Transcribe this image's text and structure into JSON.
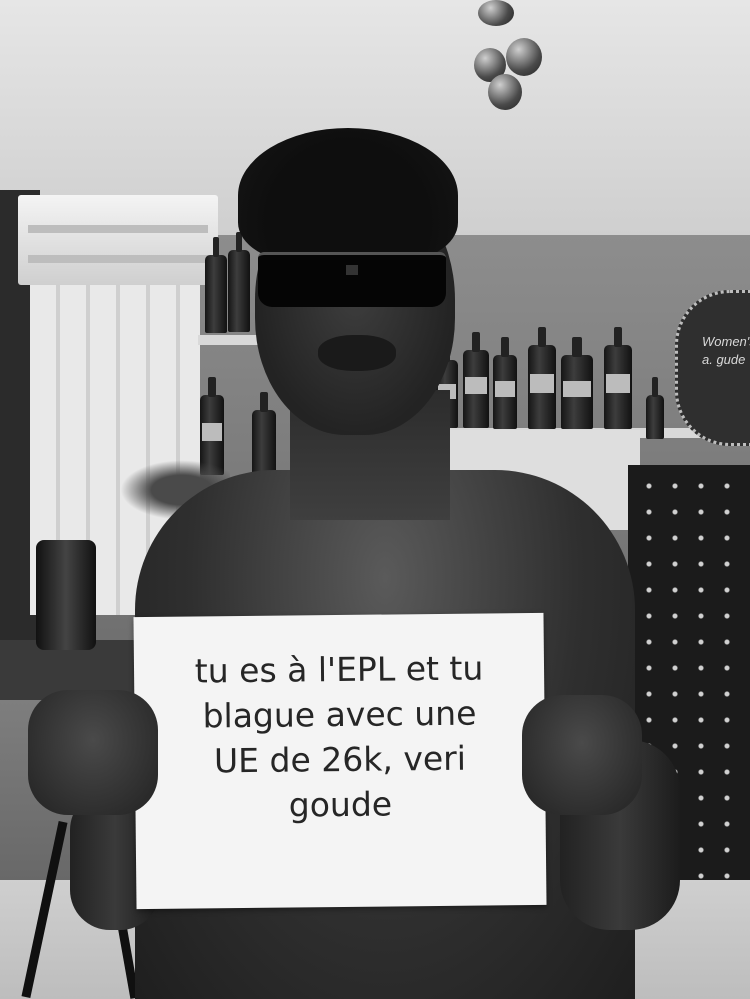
{
  "sign": {
    "lines": [
      "tu es à l'EPL et tu",
      "blague avec une",
      "UE de 26k, veri",
      "goude"
    ]
  },
  "background_sign": {
    "lines": [
      "Women's",
      "a. gude"
    ]
  },
  "colors": {
    "sign_paper": "#f4f4f4",
    "sign_ink": "#262626",
    "image_tone": "grayscale"
  }
}
